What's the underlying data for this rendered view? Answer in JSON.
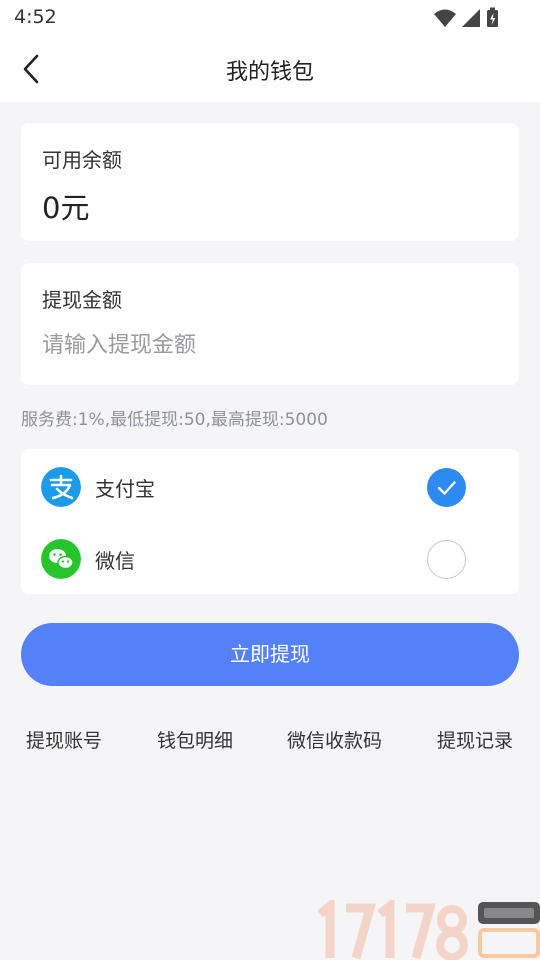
{
  "status_bar": {
    "time": "4:52"
  },
  "header": {
    "title": "我的钱包"
  },
  "balance": {
    "label": "可用余额",
    "value": "0元"
  },
  "withdraw": {
    "label": "提现金额",
    "placeholder": "请输入提现金额"
  },
  "fee_note": "服务费:1%,最低提现:50,最高提现:5000",
  "payment_methods": [
    {
      "label": "支付宝",
      "icon": "alipay-icon",
      "selected": true
    },
    {
      "label": "微信",
      "icon": "wechat-icon",
      "selected": false
    }
  ],
  "submit_label": "立即提现",
  "bottom_links": [
    "提现账号",
    "钱包明细",
    "微信收款码",
    "提现记录"
  ],
  "colors": {
    "primary_button": "#5481f7",
    "radio_checked": "#2d8af0",
    "alipay": "#1c9bea",
    "wechat": "#25c52b",
    "background": "#f5f5f7"
  }
}
